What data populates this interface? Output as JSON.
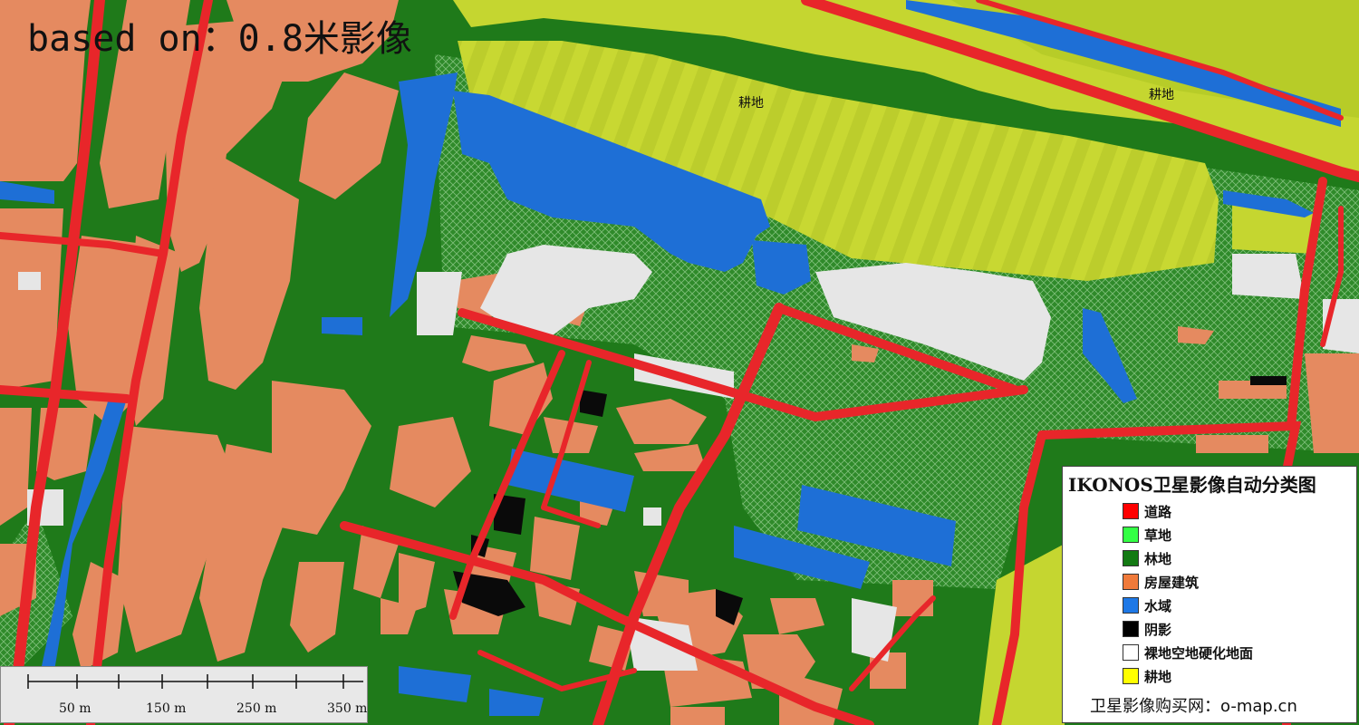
{
  "title_overlay": "based on：0.8米影像",
  "map_labels": [
    "耕地",
    "耕地"
  ],
  "legend": {
    "title": "IKONOS卫星影像自动分类图",
    "items": [
      {
        "label": "道路",
        "color": "#ff0000"
      },
      {
        "label": "草地",
        "color": "#33ff44"
      },
      {
        "label": "林地",
        "color": "#137a13"
      },
      {
        "label": "房屋建筑",
        "color": "#f07a3a"
      },
      {
        "label": "水域",
        "color": "#1e78e6"
      },
      {
        "label": "阴影",
        "color": "#000000"
      },
      {
        "label": "裸地空地硬化地面",
        "color": "#ffffff"
      },
      {
        "label": "耕地",
        "color": "#ffff00"
      }
    ],
    "source": "卫星影像购买网：o-map.cn"
  },
  "scale_bar": {
    "labels": [
      "50 m",
      "150 m",
      "250 m",
      "350 m"
    ]
  },
  "colors": {
    "road": "#e8262a",
    "forest": "#1f7a1a",
    "building": "#e58a60",
    "water": "#1e6fd6",
    "farmland": "#c5d630",
    "bare": "#e6e6e6",
    "shadow": "#0a0a0a"
  }
}
